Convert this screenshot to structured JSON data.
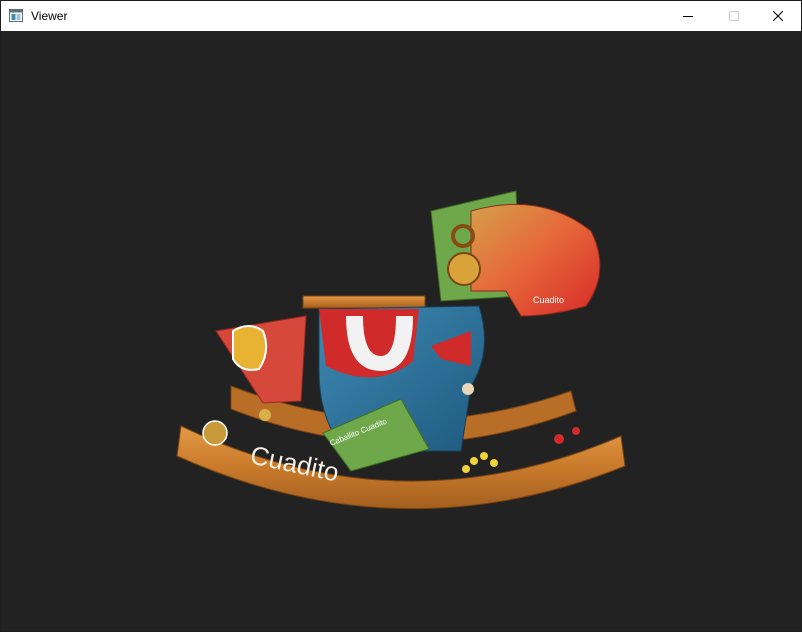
{
  "window": {
    "title": "Viewer",
    "icon": "app-window-icon",
    "controls": [
      "minimize-icon",
      "maximize-icon",
      "close-icon"
    ]
  },
  "viewport": {
    "background": "#222222",
    "model": {
      "labels": {
        "rocker": "Cuadito",
        "head": "Cuadito",
        "card": "Caballito Cuadito"
      }
    }
  }
}
